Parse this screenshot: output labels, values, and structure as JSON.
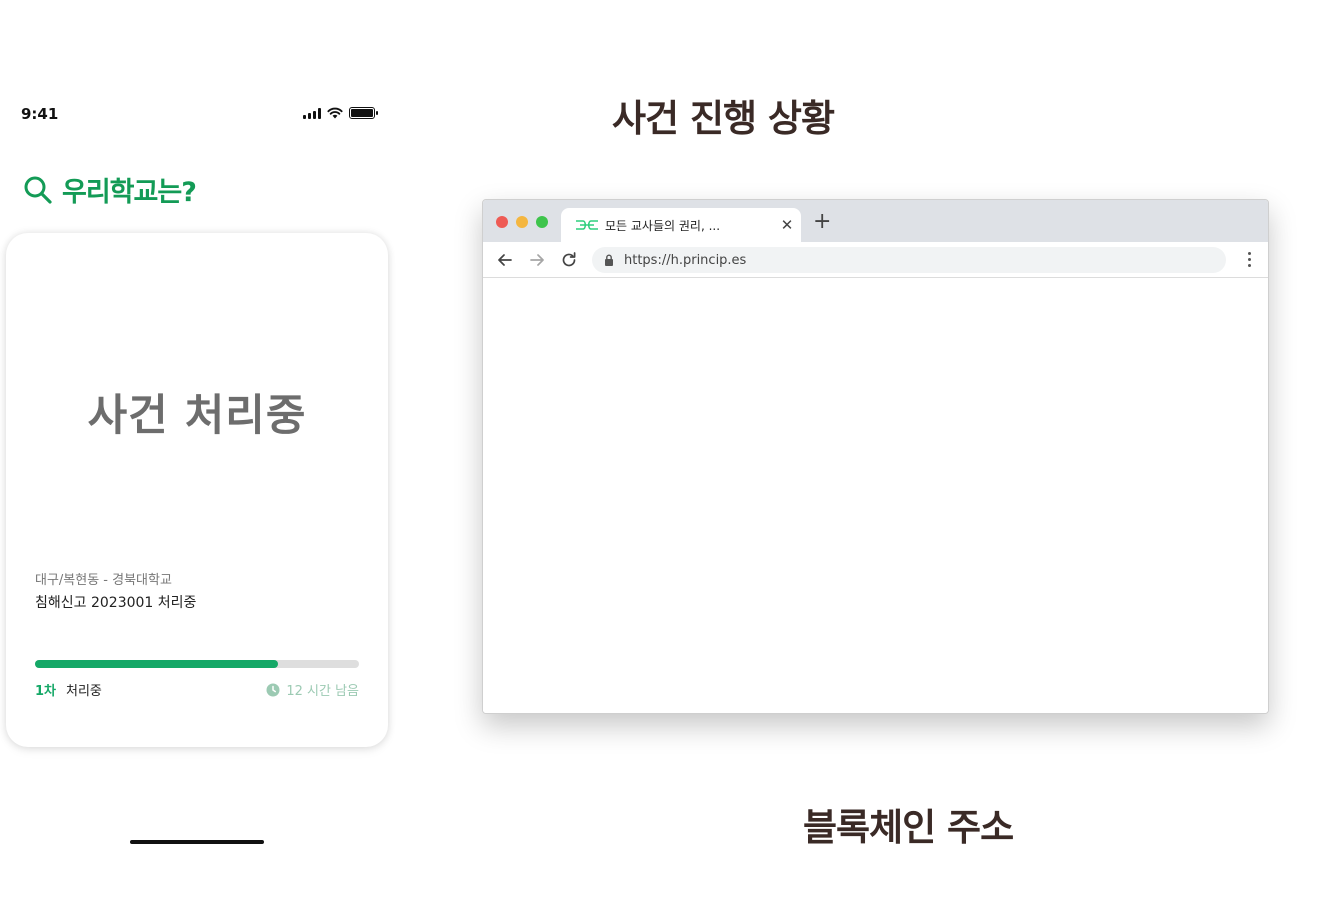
{
  "phone": {
    "status_time": "9:41",
    "header_title": "우리학교는?",
    "card": {
      "status": "사건 처리중",
      "location": "대구/복현동 - 경북대학교",
      "case": "침해신고 2023001 처리중",
      "progress": 0.75,
      "stage_number": "1차",
      "stage_text": "처리중",
      "time_left": "12 시간 남음"
    }
  },
  "headings": {
    "progress": "사건 진행 상황",
    "blockchain": "블록체인 주소"
  },
  "browser": {
    "tab_title": "모든 교사들의 권리, ...",
    "url": "https://h.princip.es"
  },
  "colors": {
    "brand_green": "#139b56",
    "progress_green": "#15a867",
    "heading_brown": "#3a2a26"
  }
}
